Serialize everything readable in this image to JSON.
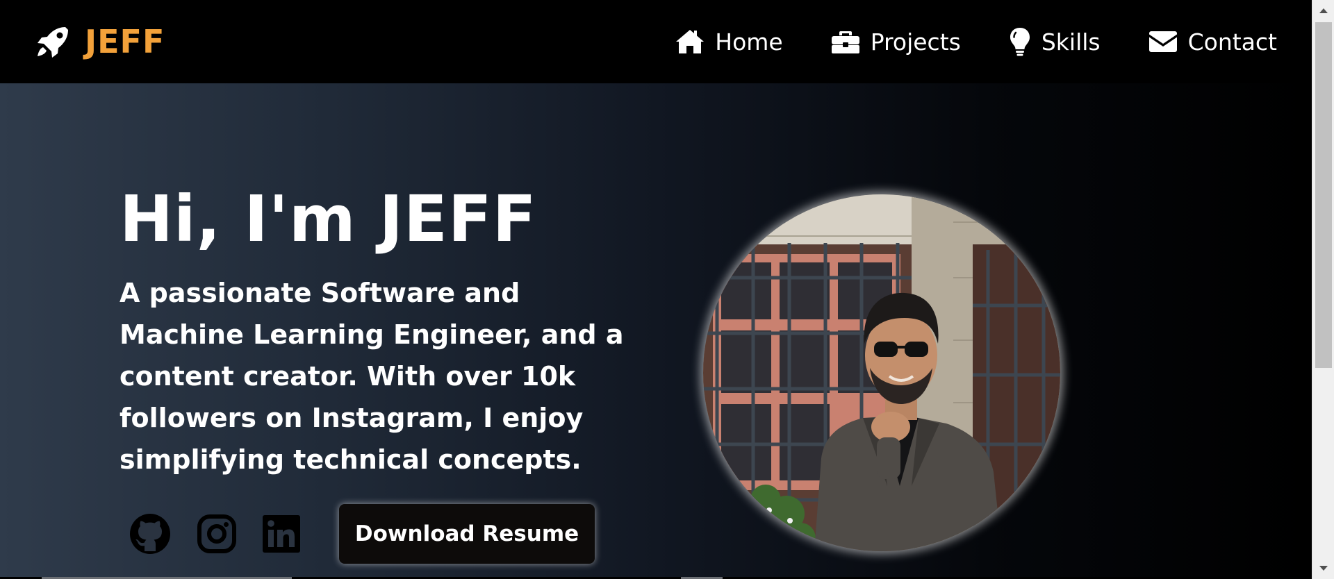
{
  "brand": {
    "name": "JEFF",
    "icon": "rocket-icon",
    "color": "#f2a13a"
  },
  "nav": {
    "items": [
      {
        "label": "Home",
        "icon": "home-icon"
      },
      {
        "label": "Projects",
        "icon": "briefcase-icon"
      },
      {
        "label": "Skills",
        "icon": "lightbulb-icon"
      },
      {
        "label": "Contact",
        "icon": "envelope-icon"
      }
    ]
  },
  "hero": {
    "title": "Hi, I'm JEFF",
    "subtitle": "A passionate Software and Machine Learning Engineer, and a content creator. With over 10k followers on Instagram, I enjoy simplifying technical concepts.",
    "social": [
      {
        "icon": "github-icon"
      },
      {
        "icon": "instagram-icon"
      },
      {
        "icon": "linkedin-icon"
      }
    ],
    "resume_button": "Download Resume",
    "portrait_icon": "profile-photo"
  },
  "colors": {
    "navbar_bg": "#000000",
    "hero_gradient_start": "#2f3b4b",
    "hero_gradient_end": "#000000",
    "button_bg": "#0d0b0a"
  }
}
